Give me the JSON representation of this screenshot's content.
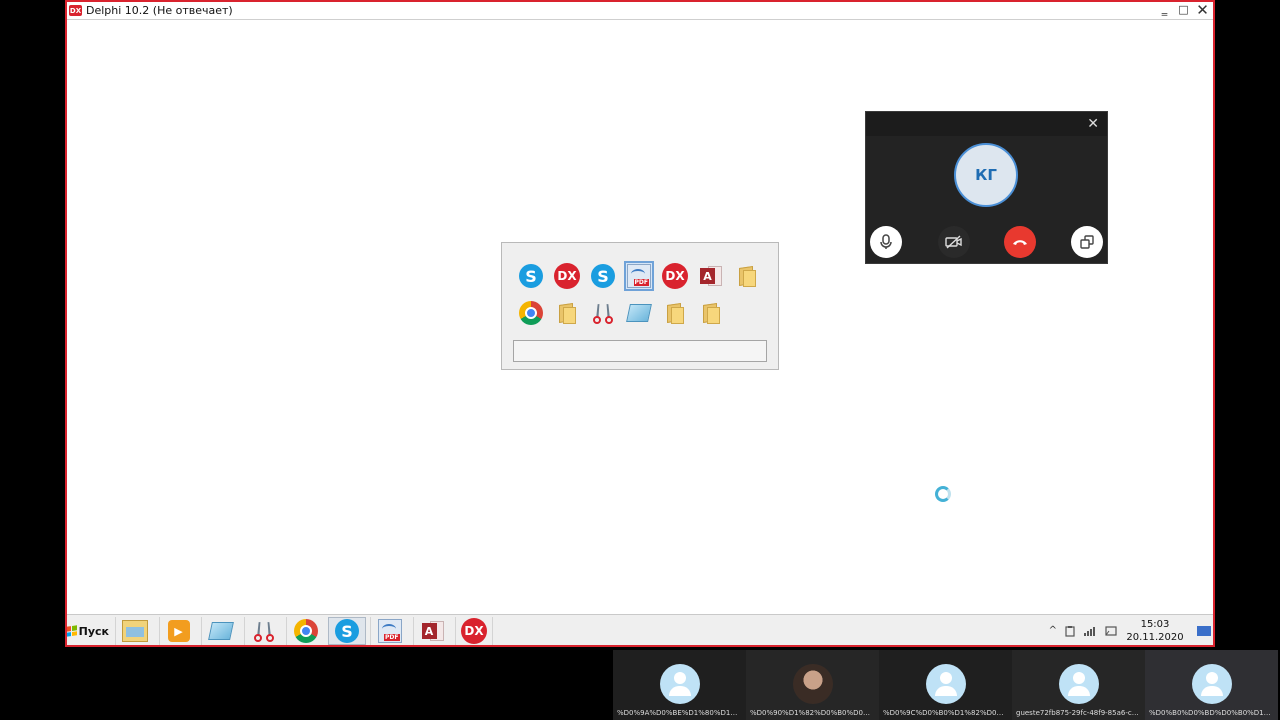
{
  "window": {
    "app_icon_label": "DX",
    "title": "Delphi 10.2 (Не отвечает)",
    "btn_minimize": "‗",
    "btn_maximize": "□",
    "btn_close": "✕"
  },
  "switcher": {
    "row1": [
      {
        "name": "skype-icon",
        "label": "S"
      },
      {
        "name": "delphi-dx-icon",
        "label": "DX"
      },
      {
        "name": "skype-icon",
        "label": "S"
      },
      {
        "name": "pdf-printer-icon",
        "label": "PDF",
        "selected": true
      },
      {
        "name": "delphi-dx-icon",
        "label": "DX"
      },
      {
        "name": "access-icon",
        "label": "A"
      },
      {
        "name": "folder-icon",
        "label": ""
      }
    ],
    "row2": [
      {
        "name": "chrome-icon",
        "label": ""
      },
      {
        "name": "downloads-folder-icon",
        "label": ""
      },
      {
        "name": "scissors-icon",
        "label": ""
      },
      {
        "name": "notebook-icon",
        "label": ""
      },
      {
        "name": "folder-icon",
        "label": ""
      },
      {
        "name": "folder-icon",
        "label": ""
      }
    ]
  },
  "call": {
    "close_label": "✕",
    "initials": "КГ",
    "mic_icon": "microphone-icon",
    "cam_icon": "camera-off-icon",
    "end_icon": "hangup-icon",
    "share_icon": "popout-icon",
    "colors": {
      "end": "#e8392f",
      "avatar_ring": "#4a8fd6"
    }
  },
  "taskbar": {
    "start_label": "Пуск",
    "pdf_tag": "PDF",
    "access_letter": "A",
    "dx_label": "DX",
    "skype_label": "S",
    "tray_up": "^",
    "time": "15:03",
    "date": "20.11.2020"
  },
  "participants": [
    {
      "name": "%D0%9A%D0%BE%D1%80%D1%88...",
      "avatar": "default"
    },
    {
      "name": "%D0%90%D1%82%D0%B0%D0%B5...",
      "avatar": "photo"
    },
    {
      "name": "%D0%9C%D0%B0%D1%82%D0%B2...",
      "avatar": "default"
    },
    {
      "name": "gueste72fb875-29fc-48f9-85a6-c7...",
      "avatar": "default"
    },
    {
      "name": "%D0%B0%D0%BD%D0%B0%D1%8...",
      "avatar": "default"
    }
  ]
}
